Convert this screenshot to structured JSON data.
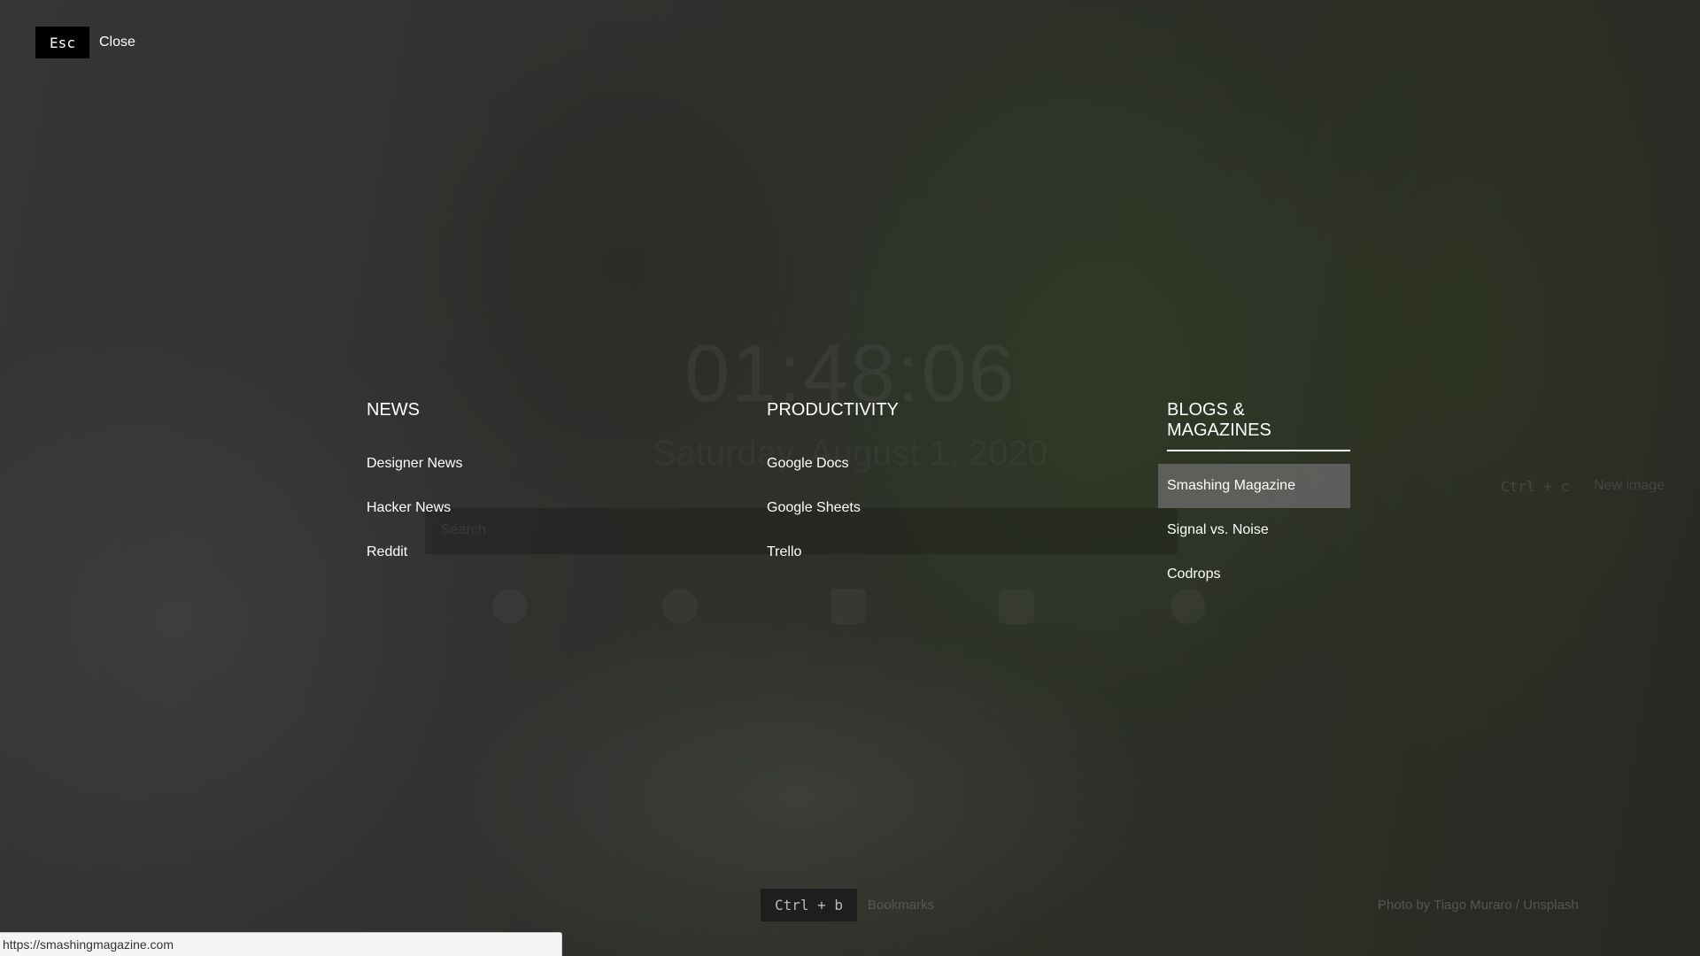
{
  "esc": {
    "key": "Esc",
    "label": "Close"
  },
  "background_page": {
    "clock": "01:48:06",
    "date": "Saturday, August 1, 2020",
    "search_placeholder": "Search",
    "new_image_shortcut": "Ctrl + c",
    "new_image_label": "New image",
    "quick_links": [
      "hacker-news-icon",
      "github-icon",
      "dev-icon",
      "gmail-icon",
      "reddit-icon"
    ]
  },
  "columns": [
    {
      "title": "NEWS",
      "items": [
        "Designer News",
        "Hacker News",
        "Reddit"
      ]
    },
    {
      "title": "PRODUCTIVITY",
      "items": [
        "Google Docs",
        "Google Sheets",
        "Trello"
      ]
    },
    {
      "title": "BLOGS & MAGAZINES",
      "items": [
        "Smashing Magazine",
        "Signal vs. Noise",
        "Codrops"
      ]
    }
  ],
  "active_column": "BLOGS & MAGAZINES",
  "selected_item": "Smashing Magazine",
  "bottom": {
    "bookmarks_shortcut": "Ctrl + b",
    "bookmarks_label": "Bookmarks",
    "credit": "Photo by Tiago Muraro / Unsplash"
  },
  "status_url": "https://smashingmagazine.com"
}
